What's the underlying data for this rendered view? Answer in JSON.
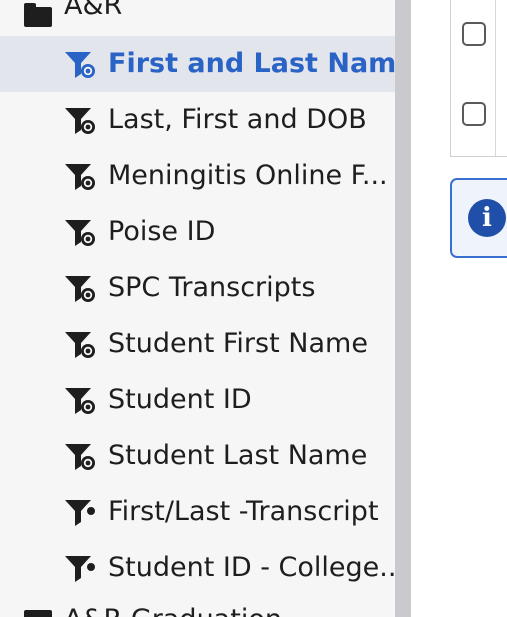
{
  "sidebar": {
    "folder_top": {
      "label": "A&R",
      "icon": "folder-open-icon"
    },
    "items": [
      {
        "label": "First and Last Name",
        "icon": "shared-filter-icon",
        "selected": true
      },
      {
        "label": "Last, First and DOB",
        "icon": "shared-filter-icon"
      },
      {
        "label": "Meningitis Online F...",
        "icon": "shared-filter-icon"
      },
      {
        "label": "Poise ID",
        "icon": "shared-filter-icon"
      },
      {
        "label": "SPC Transcripts",
        "icon": "shared-filter-icon"
      },
      {
        "label": "Student First Name",
        "icon": "shared-filter-icon"
      },
      {
        "label": "Student ID",
        "icon": "shared-filter-icon"
      },
      {
        "label": "Student Last Name",
        "icon": "shared-filter-icon"
      },
      {
        "label": "First/Last -Transcript",
        "icon": "filter-icon"
      },
      {
        "label": "Student ID - College...",
        "icon": "filter-icon"
      }
    ],
    "folder_bottom": {
      "label": "A&R Graduation",
      "icon": "folder-closed-icon"
    }
  },
  "main": {
    "checkboxes": [
      {
        "checked": false
      },
      {
        "checked": false
      }
    ],
    "info_icon": "info-icon"
  },
  "colors": {
    "accent": "#2a63c6",
    "selected_bg": "#e3e5ec",
    "text": "#1e1e1e",
    "info_icon": "#1f4fa8"
  }
}
